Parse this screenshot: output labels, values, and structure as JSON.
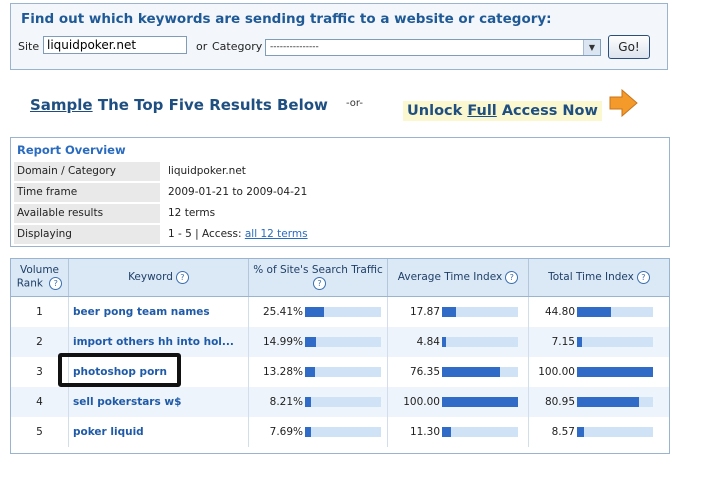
{
  "search": {
    "heading": "Find out which keywords are sending traffic to a website or category:",
    "site_label": "Site",
    "site_value": "liquidpoker.net",
    "or_label": "or",
    "category_label": "Category",
    "category_value": "---------------",
    "go_label": "Go!"
  },
  "promo": {
    "sample_word": "Sample",
    "sample_rest": " The Top Five Results Below",
    "or_text": "-or-",
    "unlock_pre": "Unlock ",
    "unlock_full": "Full",
    "unlock_post": " Access Now",
    "arrow_icon": "orange-arrow-right-icon"
  },
  "overview": {
    "title": "Report Overview",
    "rows": [
      {
        "key": "Domain / Category",
        "value": "liquidpoker.net"
      },
      {
        "key": "Time frame",
        "value": "2009-01-21 to 2009-04-21"
      },
      {
        "key": "Available results",
        "value": "12 terms"
      },
      {
        "key": "Displaying",
        "value": "1 - 5 | Access: ",
        "link": "all 12 terms"
      }
    ]
  },
  "table": {
    "headers": {
      "rank": "Volume Rank",
      "keyword": "Keyword",
      "pct": "% of Site's Search Traffic",
      "avg": "Average Time Index",
      "total": "Total Time Index"
    },
    "help_icon": "help-question-icon",
    "bar_color": "#2f6bc7",
    "rows": [
      {
        "rank": "1",
        "keyword": "beer pong team names",
        "pct": "25.41%",
        "pct_v": 25.41,
        "avg": "17.87",
        "avg_v": 17.87,
        "total": "44.80",
        "total_v": 44.8
      },
      {
        "rank": "2",
        "keyword": "import others hh into hol...",
        "pct": "14.99%",
        "pct_v": 14.99,
        "avg": "4.84",
        "avg_v": 4.84,
        "total": "7.15",
        "total_v": 7.15
      },
      {
        "rank": "3",
        "keyword": "photoshop porn",
        "pct": "13.28%",
        "pct_v": 13.28,
        "avg": "76.35",
        "avg_v": 76.35,
        "total": "100.00",
        "total_v": 100.0
      },
      {
        "rank": "4",
        "keyword": "sell pokerstars w$",
        "pct": "8.21%",
        "pct_v": 8.21,
        "avg": "100.00",
        "avg_v": 100.0,
        "total": "80.95",
        "total_v": 80.95
      },
      {
        "rank": "5",
        "keyword": "poker liquid",
        "pct": "7.69%",
        "pct_v": 7.69,
        "avg": "11.30",
        "avg_v": 11.3,
        "total": "8.57",
        "total_v": 8.57
      }
    ]
  }
}
